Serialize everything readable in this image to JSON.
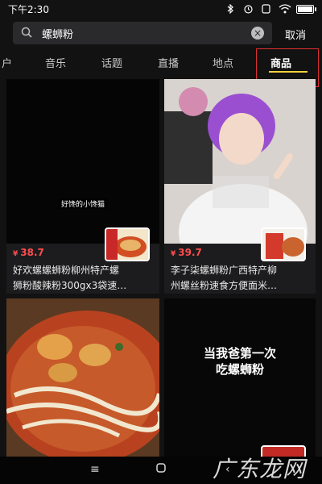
{
  "status": {
    "time": "下午2:30",
    "battery_level": 0.9
  },
  "search": {
    "query": "螺蛳粉",
    "cancel_label": "取消"
  },
  "tabs": [
    {
      "label": "户"
    },
    {
      "label": "音乐"
    },
    {
      "label": "话题"
    },
    {
      "label": "直播"
    },
    {
      "label": "地点"
    },
    {
      "label": "商品"
    }
  ],
  "active_tab": "商品",
  "cards": [
    {
      "price": "38.7",
      "currency": "¥",
      "title_line1": "好欢螺螺蛳粉柳州特产螺",
      "title_line2": "狮粉酸辣粉300gx3袋速…",
      "overlay_text": "好馋的小馋猫"
    },
    {
      "price": "39.7",
      "currency": "¥",
      "title_line1": "李子柒螺蛳粉广西特产柳",
      "title_line2": "州螺丝粉速食方便面米…"
    },
    {
      "price": "",
      "title_line1": "",
      "title_line2": ""
    },
    {
      "caption_line1": "当我爸第一次",
      "caption_line2": "吃螺蛳粉"
    }
  ],
  "watermark": "广东龙网",
  "colors": {
    "accent": "#f5d23a",
    "price": "#ff4d4f",
    "highlight": "#e03030",
    "background": "#121212"
  }
}
